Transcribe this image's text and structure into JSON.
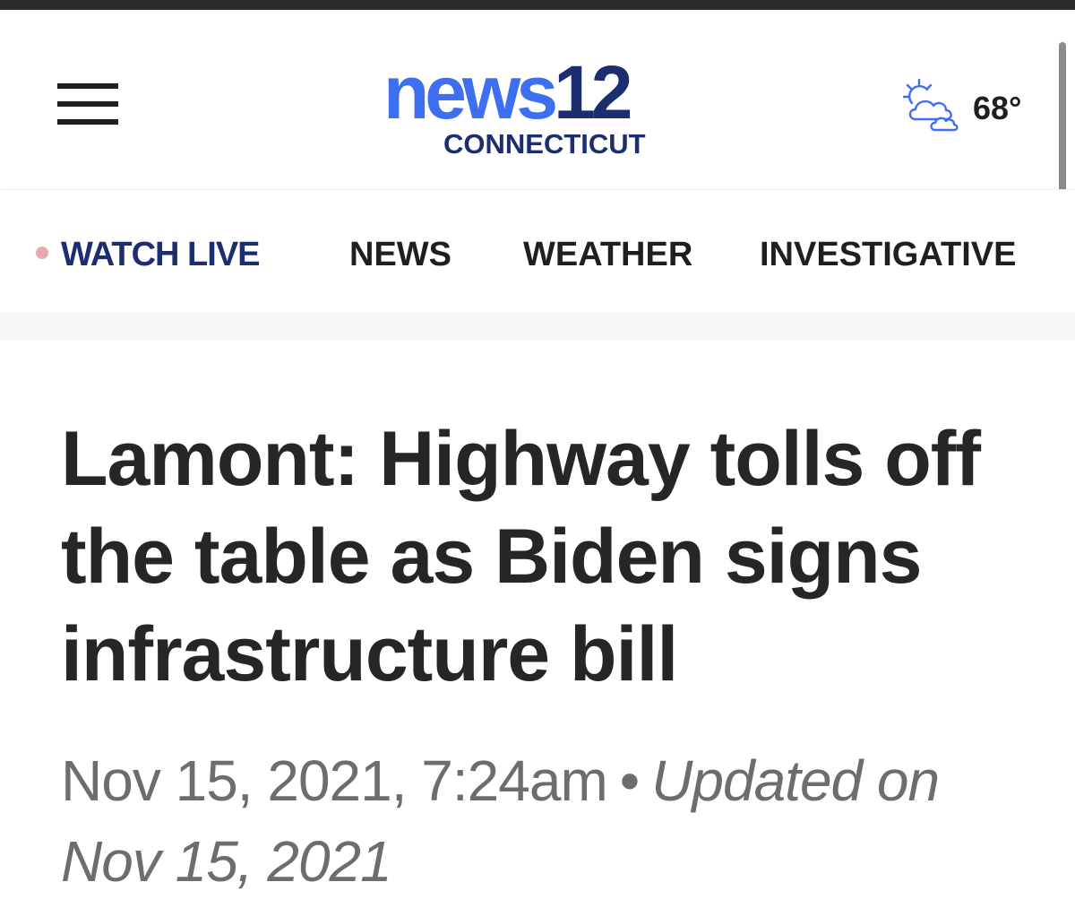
{
  "header": {
    "menu_icon": "hamburger-menu-icon",
    "logo": {
      "word": "news",
      "number": "12",
      "region": "CONNECTICUT",
      "word_color": "#3d6ff0",
      "number_color": "#1c2e6f"
    },
    "weather": {
      "icon": "partly-cloudy-icon",
      "temperature": "68°"
    }
  },
  "nav": {
    "items": [
      {
        "label": "WATCH LIVE",
        "live": true
      },
      {
        "label": "NEWS"
      },
      {
        "label": "WEATHER"
      },
      {
        "label": "INVESTIGATIVE"
      }
    ],
    "live_dot_color": "#e9a9b4"
  },
  "article": {
    "headline": "Lamont: Highway tolls off the table as Biden signs infrastructure bill",
    "published": "Nov 15, 2021, 7:24am",
    "separator": "•",
    "updated": "Updated on Nov 15, 2021"
  },
  "colors": {
    "brand_blue": "#3d6ff0",
    "brand_navy": "#1c2e6f",
    "headline_text": "#262626",
    "meta_text": "#6d6d6d"
  }
}
